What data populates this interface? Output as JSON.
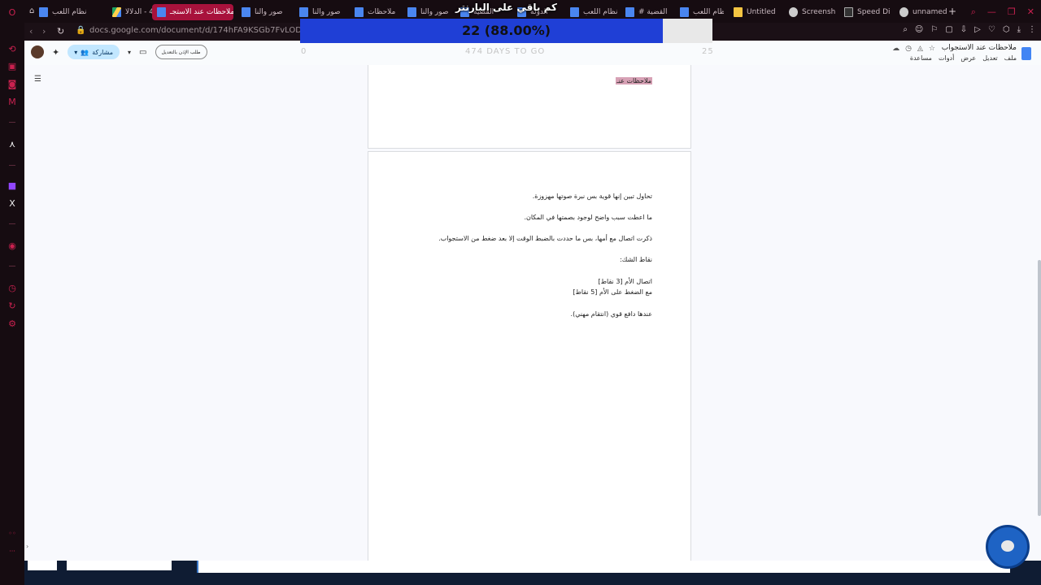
{
  "browser": {
    "tabs": [
      {
        "label": "نظام اللعب",
        "icon": "docs-icon",
        "active": false
      },
      {
        "label": "4 - الدلالا",
        "icon": "drive-icon",
        "active": false
      },
      {
        "label": "ملاحظات عند الاستجـ",
        "icon": "docs-icon",
        "active": true
      },
      {
        "label": "صور والنا",
        "icon": "docs-icon",
        "active": false
      },
      {
        "label": "صور والنا",
        "icon": "docs-icon",
        "active": false
      },
      {
        "label": "ملاحظات",
        "icon": "docs-icon",
        "active": false
      },
      {
        "label": "صور والنا",
        "icon": "docs-icon",
        "active": false
      },
      {
        "label": "القضية",
        "icon": "docs-icon",
        "active": false
      },
      {
        "label": "الدولة",
        "icon": "docs-icon",
        "active": false
      },
      {
        "label": "نظام اللعب",
        "icon": "docs-icon",
        "active": false
      },
      {
        "label": "القضية #",
        "icon": "docs-icon",
        "active": false
      },
      {
        "label": "نظام اللعب",
        "icon": "docs-icon",
        "active": false
      },
      {
        "label": "Untitled",
        "icon": "untitled-icon",
        "active": false
      },
      {
        "label": "Screensh",
        "icon": "globe-icon",
        "active": false
      },
      {
        "label": "Speed Di",
        "icon": "speed-dial-icon",
        "active": false
      },
      {
        "label": "unnamed",
        "icon": "globe-icon",
        "active": false
      }
    ],
    "url": "docs.google.com/document/d/174hFA9KSGb7FvLODtg3kV9bnq"
  },
  "overlay": {
    "title": "كم باقي على البارنتر",
    "progress_text": "22 (88.00%)",
    "progress_fraction": 0.88,
    "ghost_left": "0",
    "ghost_center": "474 DAYS TO GO",
    "ghost_right": "25"
  },
  "docs": {
    "doc_title": "ملاحظات عند الاستجواب",
    "menu": [
      "ملف",
      "تعديل",
      "عرض",
      "أدوات",
      "مساعدة"
    ],
    "share_label": "مشاركة",
    "request_edit_label": "طلب الإذن بالتعديل",
    "page1_highlight": "ملاحظات عنـ",
    "paragraphs": [
      "تحاول تبين إنها قوية بس نبرة صوتها مهزوزة.",
      "ما اعطت سبب واضح لوجود بصمتها في المكان.",
      "ذكرت اتصال مع أمها، بس ما حددت بالضبط الوقت إلا بعد ضغط من الاستجواب.",
      "نقاط الشك:",
      "اتصال الأم [3 نقاط]",
      "مع الضغط على الأم [5 نقاط]",
      "عندها دافع قوي (انتقام مهني)."
    ]
  },
  "colors": {
    "browser_accent": "#a8123c",
    "progress_fill": "#1f3fd6",
    "highlight": "#d7a1b5",
    "share_button": "#c2e7ff"
  }
}
